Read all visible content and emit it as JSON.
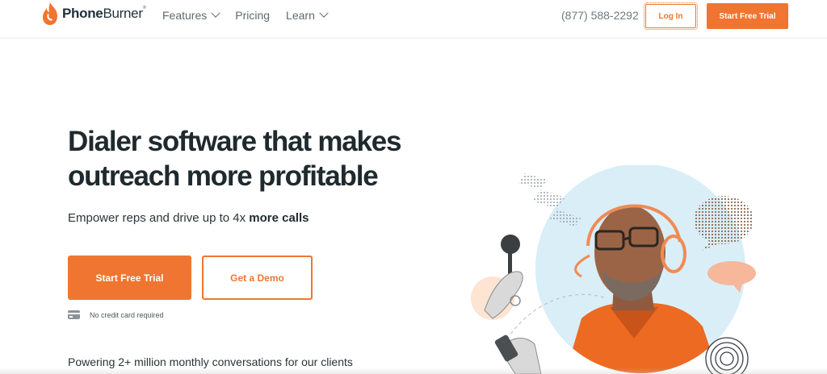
{
  "brand": {
    "name_bold": "Phone",
    "name_light": "Burner",
    "accent_color": "#F07530",
    "logo_icon": "flame-phone-logo-icon"
  },
  "nav": {
    "items": [
      {
        "label": "Features",
        "has_dropdown": true
      },
      {
        "label": "Pricing",
        "has_dropdown": false
      },
      {
        "label": "Learn",
        "has_dropdown": true
      }
    ],
    "phone": "(877) 588-2292",
    "login_label": "Log In",
    "trial_label": "Start Free Trial"
  },
  "hero": {
    "headline_line1": "Dialer software that makes",
    "headline_line2": "outreach more profitable",
    "subtitle_prefix": "Empower reps and drive up to 4x ",
    "subtitle_bold": "more calls",
    "primary_cta": "Start Free Trial",
    "secondary_cta": "Get a Demo",
    "no_cc_note": "No credit card required",
    "no_cc_icon": "credit-card-icon",
    "powering": "Powering 2+ million monthly conversations for our clients"
  }
}
